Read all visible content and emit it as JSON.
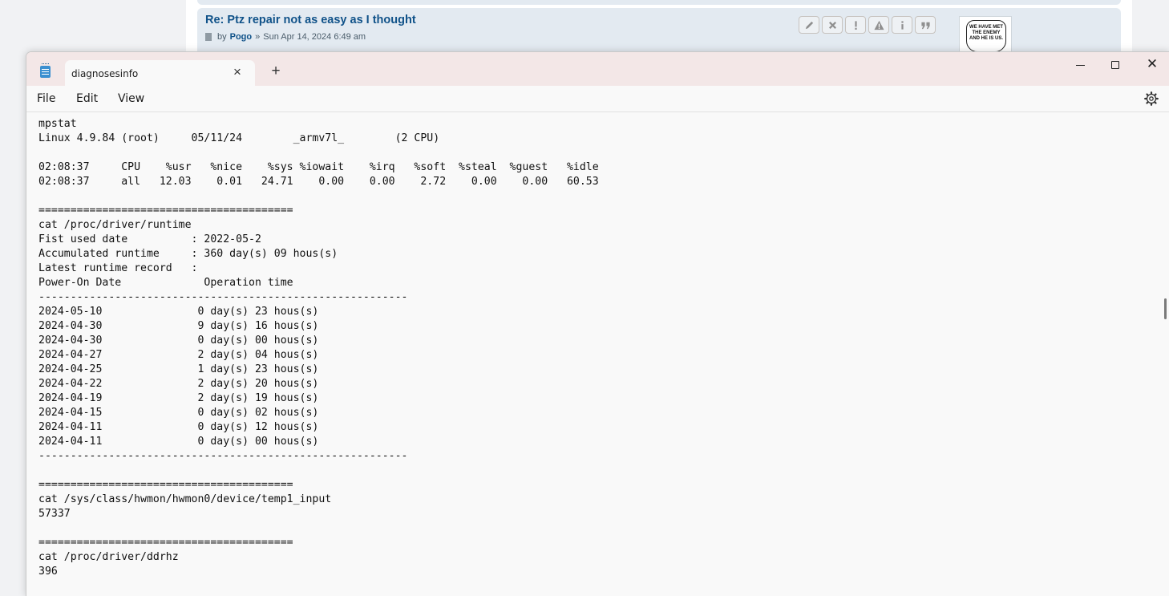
{
  "forum": {
    "post_title": "Re: Ptz repair not as easy as I thought",
    "by_label": "by",
    "author": "Pogo",
    "separator": "»",
    "date": "Sun Apr 14, 2024 6:49 am",
    "avatar_text": "WE HAVE MET THE ENEMY AND HE IS US."
  },
  "window": {
    "tab_title": "diagnosesinfo",
    "new_tab": "+",
    "menu": {
      "file": "File",
      "edit": "Edit",
      "view": "View"
    }
  },
  "editor": {
    "lines": [
      "mpstat",
      "Linux 4.9.84 (root)     05/11/24        _armv7l_        (2 CPU)",
      "",
      "02:08:37     CPU    %usr   %nice    %sys %iowait    %irq   %soft  %steal  %guest   %idle",
      "02:08:37     all   12.03    0.01   24.71    0.00    0.00    2.72    0.00    0.00   60.53",
      "",
      "========================================",
      "cat /proc/driver/runtime",
      "Fist used date          : 2022-05-2",
      "Accumulated runtime     : 360 day(s) 09 hous(s)",
      "Latest runtime record   :",
      "Power-On Date             Operation time",
      "----------------------------------------------------------",
      "2024-05-10               0 day(s) 23 hous(s)",
      "2024-04-30               9 day(s) 16 hous(s)",
      "2024-04-30               0 day(s) 00 hous(s)",
      "2024-04-27               2 day(s) 04 hous(s)",
      "2024-04-25               1 day(s) 23 hous(s)",
      "2024-04-22               2 day(s) 20 hous(s)",
      "2024-04-19               2 day(s) 19 hous(s)",
      "2024-04-15               0 day(s) 02 hous(s)",
      "2024-04-11               0 day(s) 12 hous(s)",
      "2024-04-11               0 day(s) 00 hous(s)",
      "----------------------------------------------------------",
      "",
      "========================================",
      "cat /sys/class/hwmon/hwmon0/device/temp1_input",
      "57337",
      "",
      "========================================",
      "cat /proc/driver/ddrhz",
      "396"
    ]
  }
}
